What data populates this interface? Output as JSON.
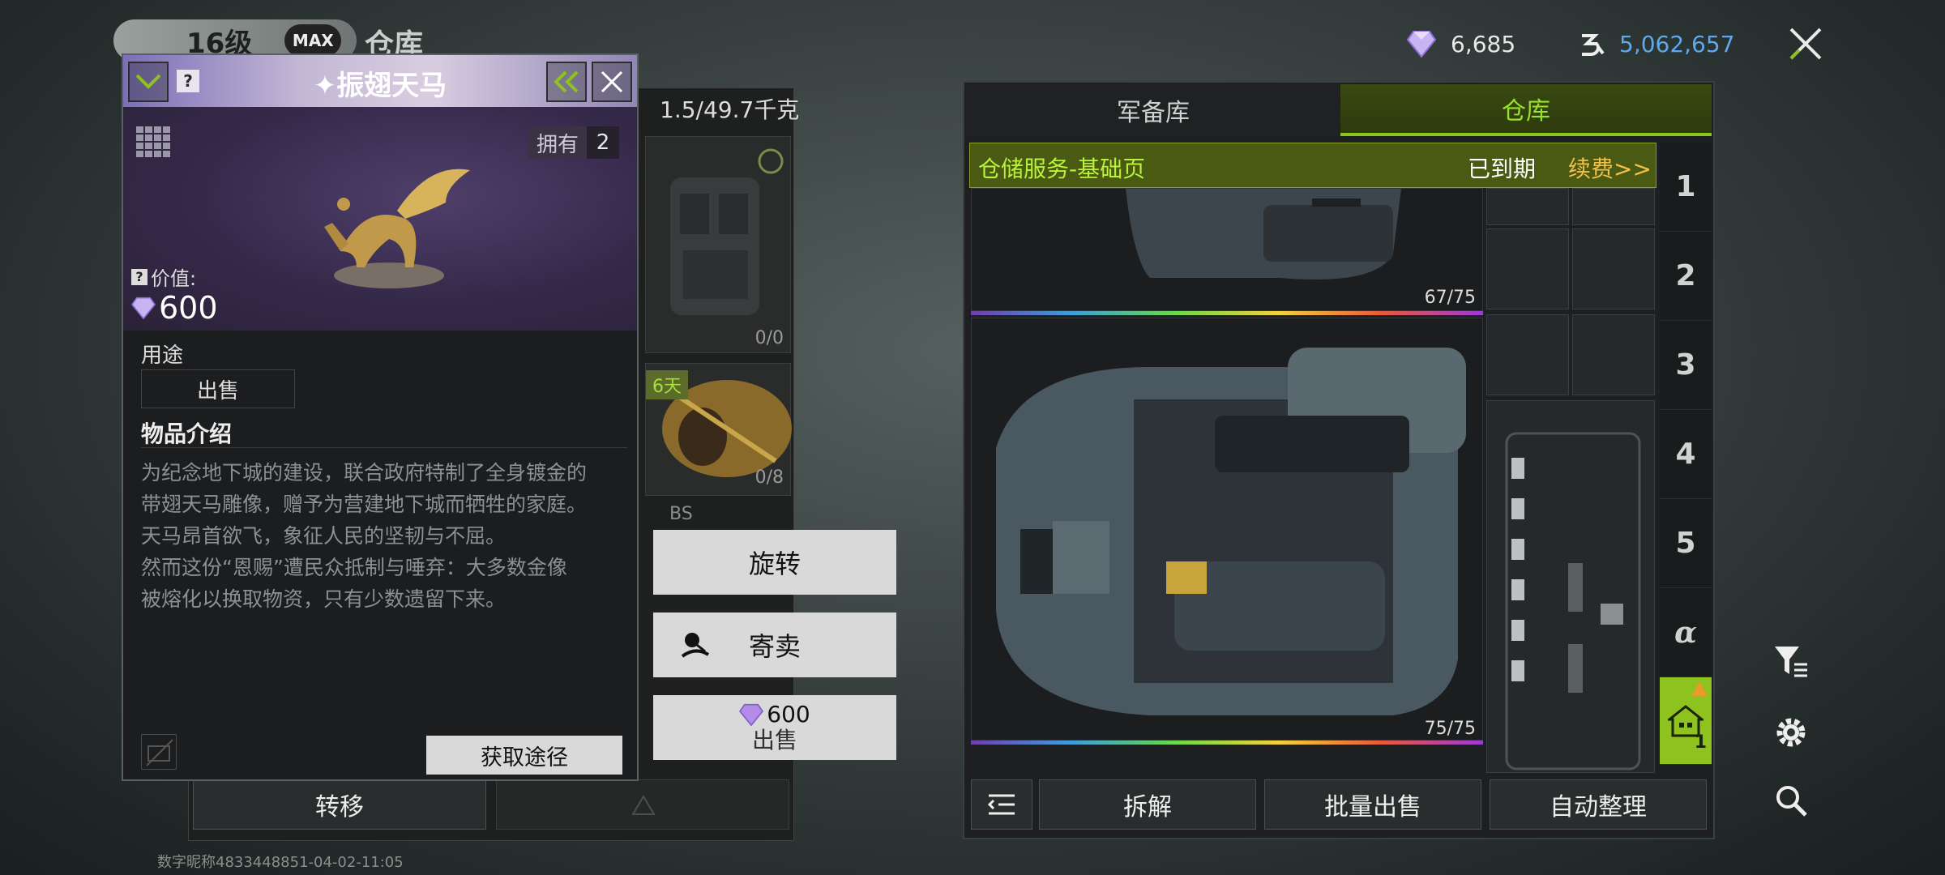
{
  "header": {
    "level": "16级",
    "max_badge": "MAX",
    "title": "仓库",
    "gems": "6,685",
    "coins": "5,062,657"
  },
  "item_detail": {
    "name": "振翅天马",
    "own_label": "拥有",
    "own_count": "2",
    "value_label": "价值:",
    "value": "600",
    "usage_title": "用途",
    "usage_sell": "出售",
    "desc_title": "物品介绍",
    "desc_lines": [
      "为纪念地下城的建设，联合政府特制了全身镀金的",
      "带翅天马雕像，赠予为营建地下城而牺牲的家庭。",
      "天马昂首欲飞，象征人民的坚韧与不屈。",
      "然而这份“恩赐”遭民众抵制与唾弃：大多数金像",
      "被熔化以换取物资，只有少数遗留下来。"
    ],
    "acquire_button": "获取途径"
  },
  "inventory": {
    "weight": "1.5/49.7千克",
    "cell1_count": "0/0",
    "cell2_badge": "6天",
    "cell2_count": "0/8",
    "cell3_tag": "BS",
    "transfer_button": "转移"
  },
  "actions": {
    "rotate": "旋转",
    "consign": "寄卖",
    "sell_price": "600",
    "sell": "出售"
  },
  "warehouse": {
    "tab_armory": "军备库",
    "tab_storage": "仓库",
    "service_title": "仓储服务-基础页",
    "service_status": "已到期",
    "service_renew": "续费>>",
    "slot1_count": "67/75",
    "slot2_count": "75/75",
    "side_tabs": [
      "1",
      "2",
      "3",
      "4",
      "5",
      "α"
    ],
    "home_tab_number": "1",
    "dismantle": "拆解",
    "bulk_sell": "批量出售",
    "auto_sort": "自动整理"
  },
  "watermark": "数字昵称4833448851-04-02-11:05",
  "colors": {
    "accent_green": "#8dc21f",
    "renew_gold": "#f2c14a",
    "coins_blue": "#5fa8ea",
    "gem_purple": "#b48be8"
  }
}
